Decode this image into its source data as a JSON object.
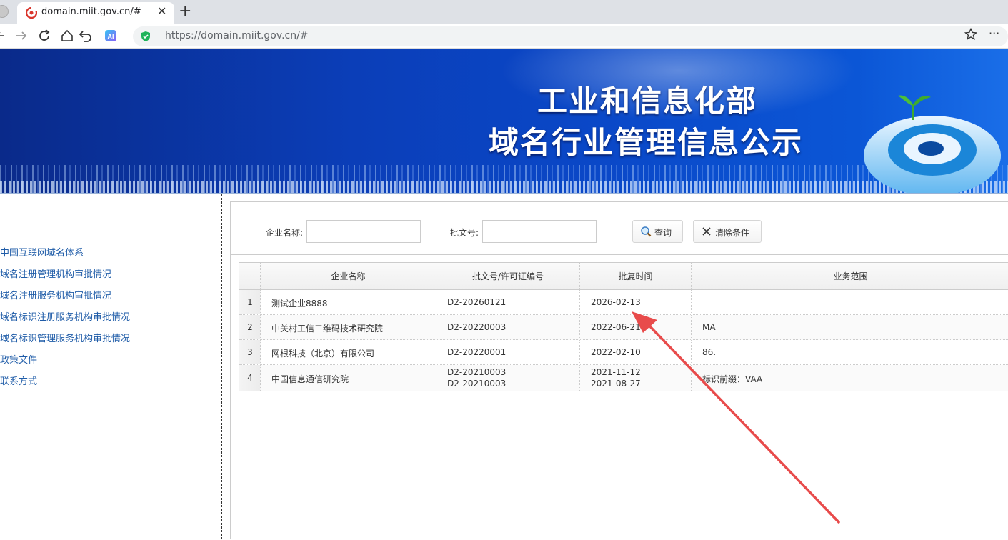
{
  "browser": {
    "tab_title": "domain.miit.gov.cn/#",
    "close_glyph": "✕",
    "new_tab_glyph": "+",
    "url": "https://domain.miit.gov.cn/#",
    "more_glyph": "···",
    "ai_badge": "AI",
    "icons": [
      "back-icon",
      "forward-icon",
      "reload-icon",
      "home-icon",
      "undo-icon",
      "ai-icon",
      "shield-icon",
      "star-icon",
      "more-icon"
    ]
  },
  "banner": {
    "line1": "工业和信息化部",
    "line2": "域名行业管理信息公示"
  },
  "sidebar": {
    "items": [
      {
        "label": "中国互联网域名体系"
      },
      {
        "label": "域名注册管理机构审批情况"
      },
      {
        "label": "域名注册服务机构审批情况"
      },
      {
        "label": "域名标识注册服务机构审批情况"
      },
      {
        "label": "域名标识管理服务机构审批情况"
      },
      {
        "label": "政策文件"
      },
      {
        "label": "联系方式"
      }
    ]
  },
  "search": {
    "company_label": "企业名称:",
    "company_value": "",
    "approval_label": "批文号:",
    "approval_value": "",
    "query_button": "查询",
    "clear_button": "清除条件"
  },
  "table": {
    "columns": [
      "企业名称",
      "批文号/许可证编号",
      "批复时间",
      "业务范围"
    ],
    "rows": [
      {
        "no": "1",
        "company": "测试企业8888",
        "license": [
          "D2-20260121"
        ],
        "date": [
          "2026-02-13"
        ],
        "scope": ""
      },
      {
        "no": "2",
        "company": "中关村工信二维码技术研究院",
        "license": [
          "D2-20220003"
        ],
        "date": [
          "2022-06-21"
        ],
        "scope": "MA"
      },
      {
        "no": "3",
        "company": "网根科技（北京）有限公司",
        "license": [
          "D2-20220001"
        ],
        "date": [
          "2022-02-10"
        ],
        "scope": "86."
      },
      {
        "no": "4",
        "company": "中国信息通信研究院",
        "license": [
          "D2-20210003",
          "D2-20210003"
        ],
        "date": [
          "2021-11-12",
          "2021-08-27"
        ],
        "scope": "标识前缀：VAA"
      }
    ]
  },
  "colors": {
    "nav_link": "#1f5ca8",
    "annotation_arrow": "#e84b4b",
    "banner_blue": "#0b3eb8"
  }
}
